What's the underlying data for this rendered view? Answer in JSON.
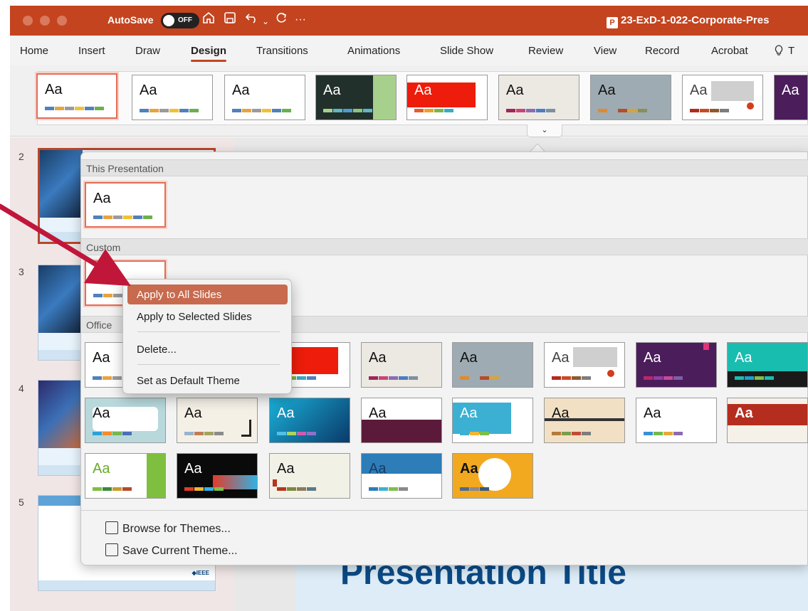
{
  "titlebar": {
    "autosave_label": "AutoSave",
    "autosave_state": "OFF",
    "doc_title": "23-ExD-1-022-Corporate-Pres",
    "more": "···"
  },
  "menu": {
    "tabs": [
      "Home",
      "Insert",
      "Draw",
      "Design",
      "Transitions",
      "Animations",
      "Slide Show",
      "Review",
      "View",
      "Record",
      "Acrobat",
      "T"
    ],
    "active": "Design"
  },
  "ribbon": {
    "theme_sample_text": "Aa",
    "expand_symbol": "⌄"
  },
  "slides": {
    "numbers": [
      "2",
      "3",
      "4",
      "5"
    ],
    "logo_text": "◆IEEE"
  },
  "theme_panel": {
    "sections": {
      "this_presentation": "This Presentation",
      "custom": "Custom",
      "office": "Office"
    },
    "sample_text": "Aa",
    "browse_label": "Browse for Themes...",
    "save_label": "Save Current Theme..."
  },
  "context_menu": {
    "items": [
      "Apply to All Slides",
      "Apply to Selected Slides",
      "Delete...",
      "Set as Default Theme"
    ],
    "highlighted": "Apply to All Slides"
  },
  "editor": {
    "slide_title": "Presentation Title"
  },
  "colors": {
    "accent": "#c4441f",
    "highlight": "#c76a4e",
    "annotation_arrow": "#c0163a",
    "title_blue": "#0b4a86"
  }
}
